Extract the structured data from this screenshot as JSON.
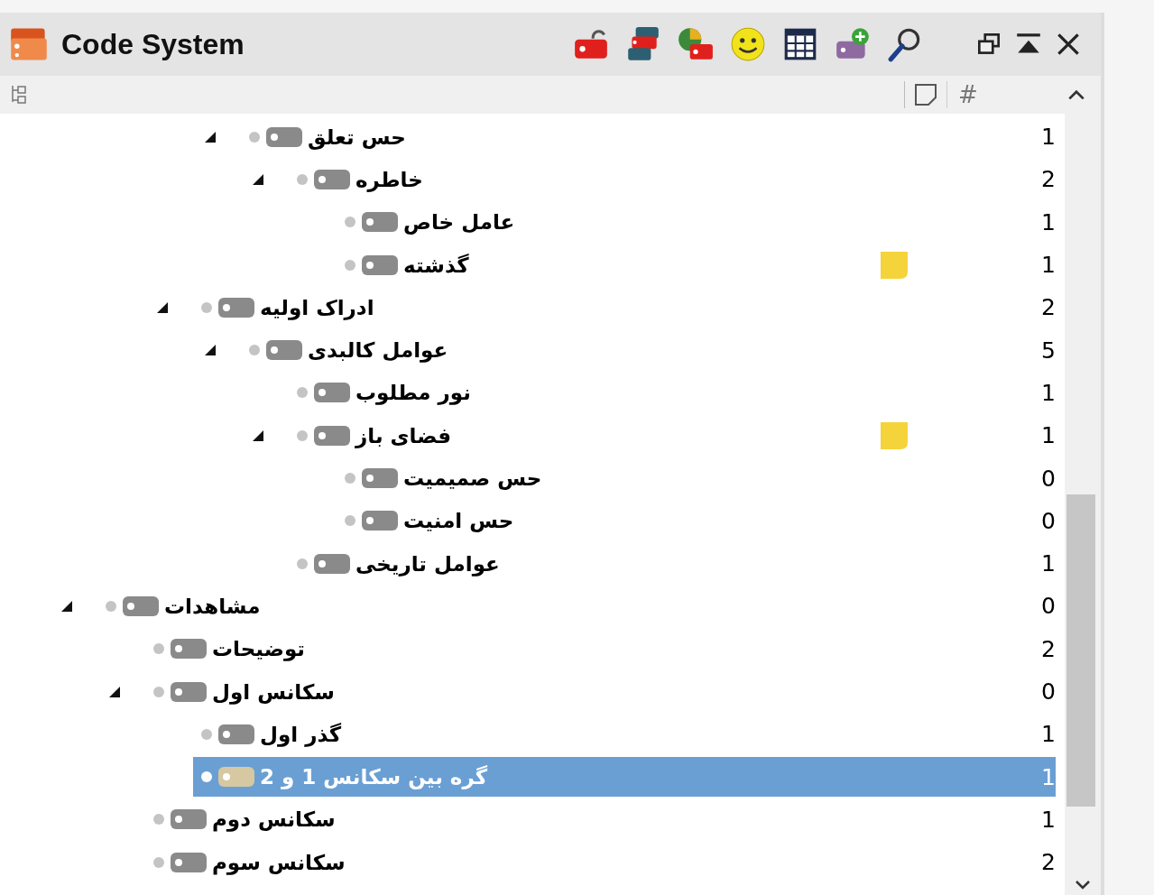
{
  "window": {
    "title": "Code System"
  },
  "columns": {
    "count_header": "#"
  },
  "tree": [
    {
      "children": [
        {
          "children": [
            {
              "children": [
                {
                  "label": "حس تعلق",
                  "count": "1",
                  "expanded": true,
                  "selected": false,
                  "memo": false,
                  "children": [
                    {
                      "label": "خاطره",
                      "count": "2",
                      "expanded": true,
                      "selected": false,
                      "memo": false,
                      "children": [
                        {
                          "label": "عامل خاص",
                          "count": "1",
                          "selected": false,
                          "memo": false
                        },
                        {
                          "label": "گذشته",
                          "count": "1",
                          "selected": false,
                          "memo": true
                        }
                      ]
                    }
                  ]
                }
              ]
            },
            {
              "label": "ادراک اولیه",
              "count": "2",
              "expanded": true,
              "selected": false,
              "memo": false,
              "children": [
                {
                  "label": "عوامل کالبدی",
                  "count": "5",
                  "expanded": true,
                  "selected": false,
                  "memo": false,
                  "children": [
                    {
                      "label": "نور مطلوب",
                      "count": "1",
                      "selected": false,
                      "memo": false
                    },
                    {
                      "label": "فضای باز",
                      "count": "1",
                      "expanded": true,
                      "selected": false,
                      "memo": true,
                      "children": [
                        {
                          "label": "حس صمیمیت",
                          "count": "0",
                          "selected": false,
                          "memo": false
                        },
                        {
                          "label": "حس امنیت",
                          "count": "0",
                          "selected": false,
                          "memo": false
                        }
                      ]
                    },
                    {
                      "label": "عوامل تاریخی",
                      "count": "1",
                      "selected": false,
                      "memo": false
                    }
                  ]
                }
              ]
            }
          ]
        }
      ]
    },
    {
      "label": "مشاهدات",
      "count": "0",
      "expanded": true,
      "selected": false,
      "memo": false,
      "children": [
        {
          "label": "توضیحات",
          "count": "2",
          "selected": false,
          "memo": false
        },
        {
          "label": "سکانس اول",
          "count": "0",
          "expanded": true,
          "selected": false,
          "memo": false,
          "children": [
            {
              "label": "گذر اول",
              "count": "1",
              "selected": false,
              "memo": false
            },
            {
              "label": "گره بین سکانس 1 و 2",
              "count": "1",
              "selected": true,
              "memo": false
            }
          ]
        },
        {
          "label": "سکانس دوم",
          "count": "1",
          "selected": false,
          "memo": false
        },
        {
          "label": "سکانس سوم",
          "count": "2",
          "selected": false,
          "memo": false
        }
      ]
    }
  ]
}
